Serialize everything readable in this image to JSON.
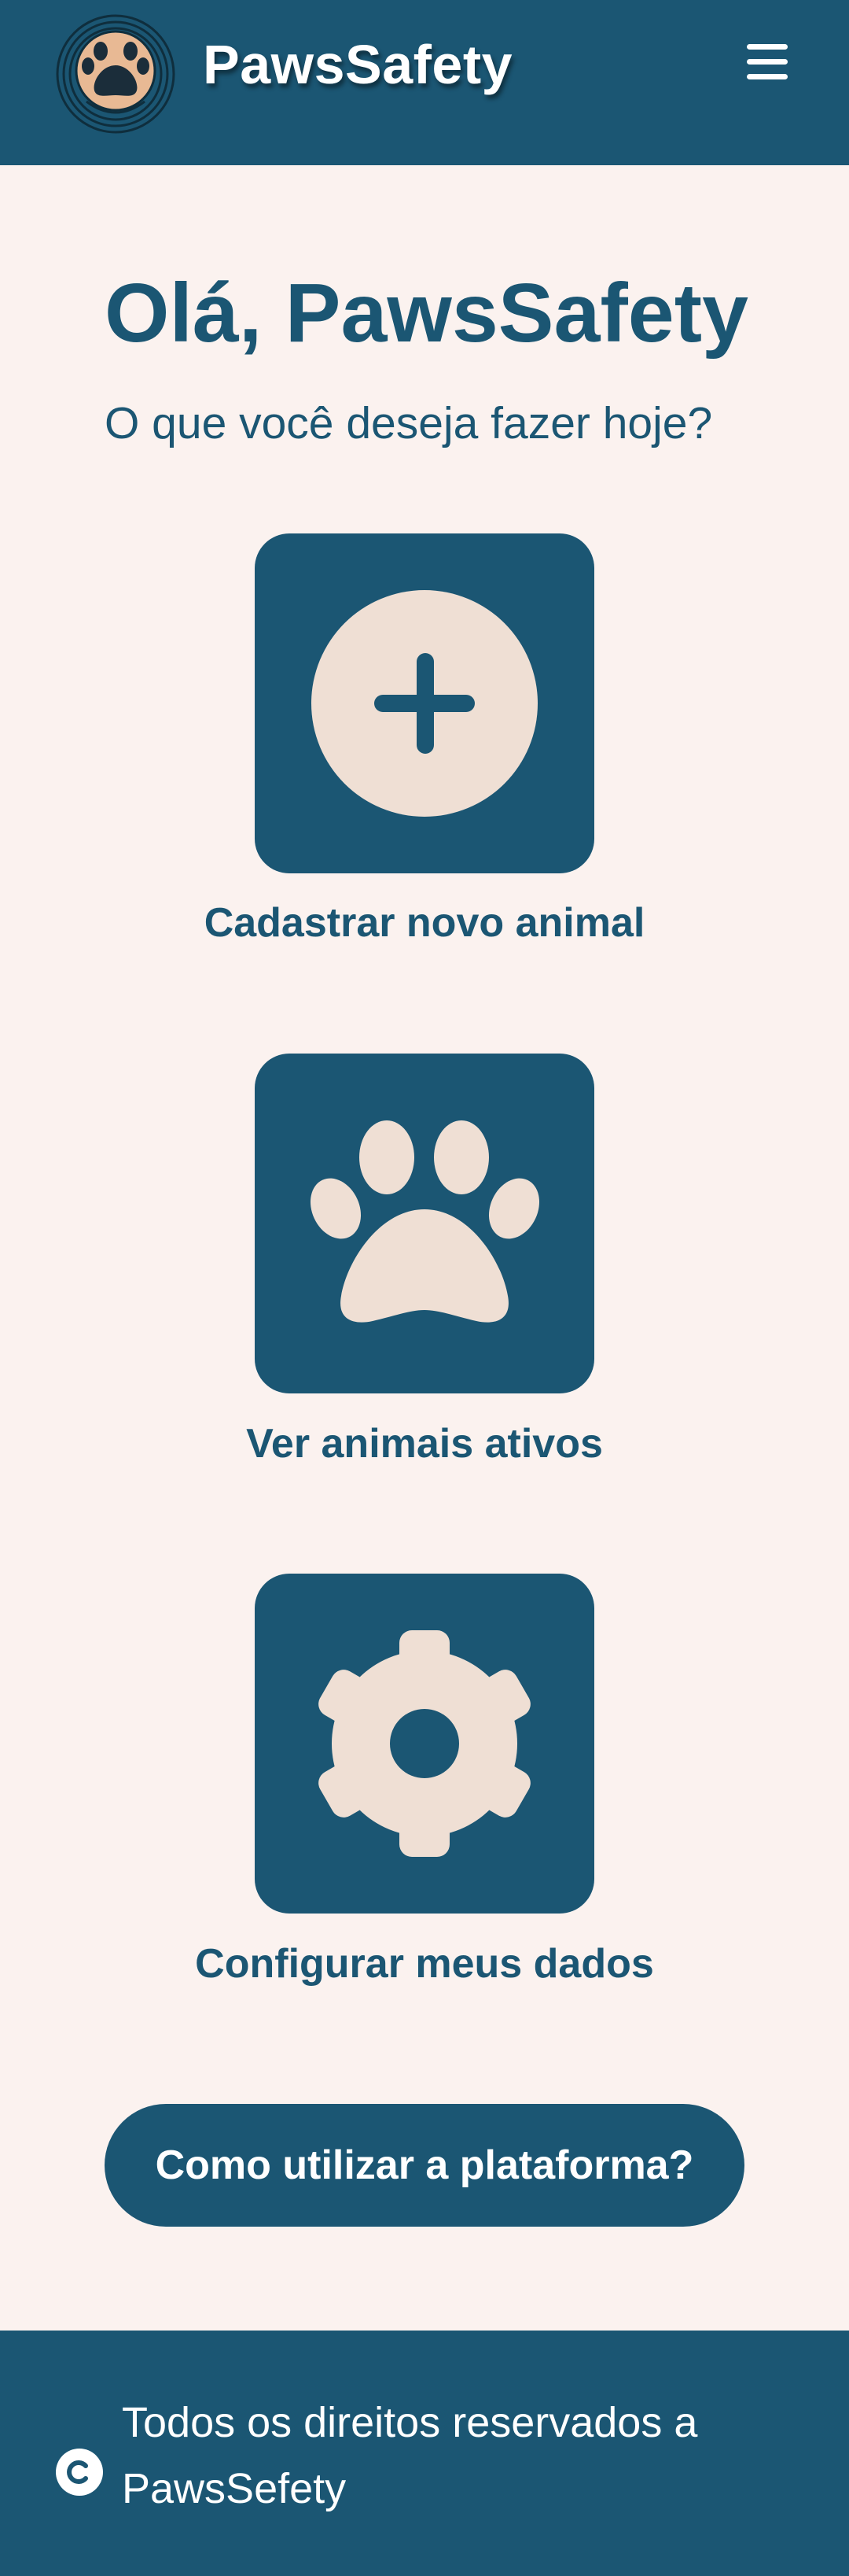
{
  "header": {
    "brand": "PawsSafety",
    "logo_icon": "paw-logo-icon",
    "menu_icon": "hamburger-menu-icon"
  },
  "main": {
    "greeting": "Olá, PawsSafety",
    "subtitle": "O que você deseja fazer hoje?",
    "actions": [
      {
        "label": "Cadastrar novo animal",
        "icon": "plus-circle-icon"
      },
      {
        "label": "Ver animais ativos",
        "icon": "paw-icon"
      },
      {
        "label": "Configurar meus dados",
        "icon": "gear-icon"
      }
    ],
    "help_button": "Como utilizar a plataforma?"
  },
  "footer": {
    "copyright_icon": "copyright-icon",
    "text": "Todos os direitos reservados a PawsSefety"
  },
  "colors": {
    "primary": "#1b5673",
    "background": "#fbf2ef",
    "icon_fill": "#efdfd4",
    "logo_accent": "#e8b994"
  }
}
